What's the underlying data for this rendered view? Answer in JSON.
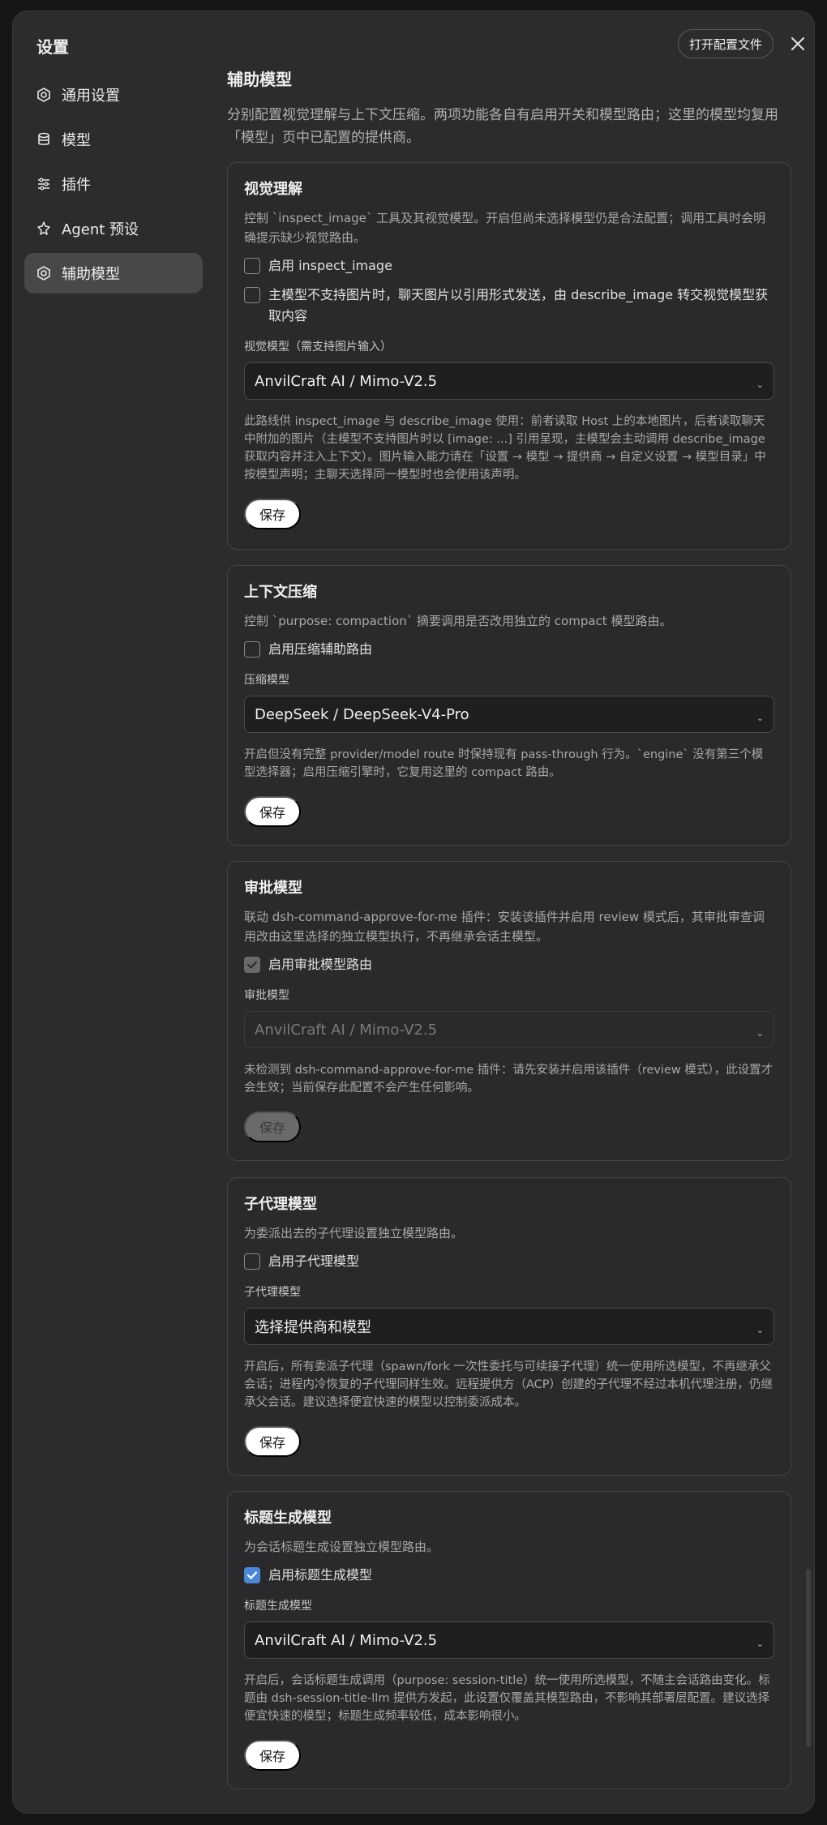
{
  "modal": {
    "title": "设置",
    "open_config_label": "打开配置文件"
  },
  "sidebar": {
    "items": [
      {
        "label": "通用设置",
        "icon": "gear-icon"
      },
      {
        "label": "模型",
        "icon": "database-icon"
      },
      {
        "label": "插件",
        "icon": "sliders-icon"
      },
      {
        "label": "Agent 预设",
        "icon": "agent-icon"
      },
      {
        "label": "辅助模型",
        "icon": "gear-icon"
      }
    ],
    "active_index": 4
  },
  "page": {
    "title": "辅助模型",
    "desc": "分别配置视觉理解与上下文压缩。两项功能各自有启用开关和模型路由；这里的模型均复用「模型」页中已配置的提供商。"
  },
  "cards": {
    "vision": {
      "title": "视觉理解",
      "desc": "控制 `inspect_image` 工具及其视觉模型。开启但尚未选择模型仍是合法配置；调用工具时会明确提示缺少视觉路由。",
      "check1": "启用 inspect_image",
      "check2": "主模型不支持图片时，聊天图片以引用形式发送，由 describe_image 转交视觉模型获取内容",
      "field_label": "视觉模型（需支持图片输入）",
      "select_value": "AnvilCraft AI / Mimo-V2.5",
      "hint": "此路线供 inspect_image 与 describe_image 使用：前者读取 Host 上的本地图片，后者读取聊天中附加的图片（主模型不支持图片时以 [image: ...] 引用呈现，主模型会主动调用 describe_image 获取内容并注入上下文）。图片输入能力请在「设置 → 模型 → 提供商 → 自定义设置 → 模型目录」中按模型声明；主聊天选择同一模型时也会使用该声明。",
      "save": "保存"
    },
    "compaction": {
      "title": "上下文压缩",
      "desc": "控制 `purpose: compaction` 摘要调用是否改用独立的 compact 模型路由。",
      "check1": "启用压缩辅助路由",
      "field_label": "压缩模型",
      "select_value": "DeepSeek / DeepSeek-V4-Pro",
      "hint": "开启但没有完整 provider/model route 时保持现有 pass-through 行为。`engine` 没有第三个模型选择器；启用压缩引擎时，它复用这里的 compact 路由。",
      "save": "保存"
    },
    "approve": {
      "title": "审批模型",
      "desc": "联动 dsh-command-approve-for-me 插件：安装该插件并启用 review 模式后，其审批审查调用改由这里选择的独立模型执行，不再继承会话主模型。",
      "check1": "启用审批模型路由",
      "field_label": "审批模型",
      "select_value": "AnvilCraft AI / Mimo-V2.5",
      "hint": "未检测到 dsh-command-approve-for-me 插件：请先安装并启用该插件（review 模式），此设置才会生效；当前保存此配置不会产生任何影响。",
      "save": "保存"
    },
    "subagent": {
      "title": "子代理模型",
      "desc": "为委派出去的子代理设置独立模型路由。",
      "check1": "启用子代理模型",
      "field_label": "子代理模型",
      "select_value": "选择提供商和模型",
      "hint": "开启后，所有委派子代理（spawn/fork 一次性委托与可续接子代理）统一使用所选模型，不再继承父会话；进程内冷恢复的子代理同样生效。远程提供方（ACP）创建的子代理不经过本机代理注册，仍继承父会话。建议选择便宜快速的模型以控制委派成本。",
      "save": "保存"
    },
    "title_gen": {
      "title": "标题生成模型",
      "desc": "为会话标题生成设置独立模型路由。",
      "check1": "启用标题生成模型",
      "field_label": "标题生成模型",
      "select_value": "AnvilCraft AI / Mimo-V2.5",
      "hint": "开启后，会话标题生成调用（purpose: session-title）统一使用所选模型，不随主会话路由变化。标题由 dsh-session-title-llm 提供方发起，此设置仅覆盖其模型路由，不影响其部署层配置。建议选择便宜快速的模型；标题生成频率较低，成本影响很小。",
      "save": "保存"
    }
  },
  "colors": {
    "accent": "#4b89d8",
    "panel": "#2c2c2e",
    "card_border": "#444446"
  }
}
